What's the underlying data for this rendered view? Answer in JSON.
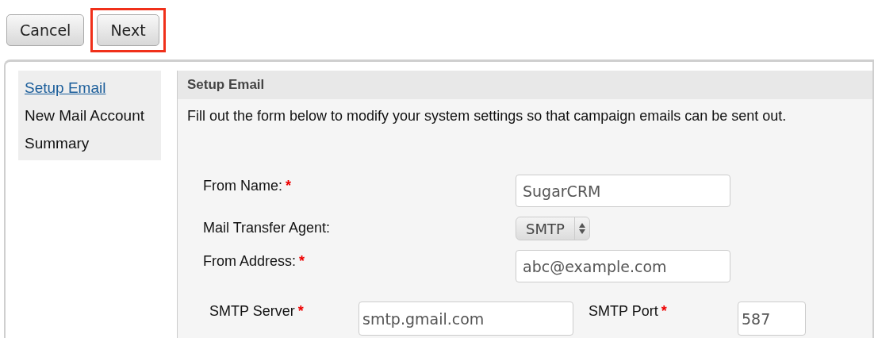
{
  "buttons": [
    {
      "label": "Cancel",
      "highlighted": false
    },
    {
      "label": "Next",
      "highlighted": true
    }
  ],
  "sidebar": {
    "items": [
      {
        "label": "Setup Email",
        "selected": true
      },
      {
        "label": "New Mail Account",
        "selected": false
      },
      {
        "label": "Summary",
        "selected": false
      }
    ]
  },
  "panel": {
    "title": "Setup Email",
    "description": "Fill out the form below to modify your system settings so that campaign emails can be sent out.",
    "fields": [
      {
        "label": "From Name:",
        "required_mark": "*",
        "kind": "text",
        "value": "SugarCRM"
      },
      {
        "label": "Mail Transfer Agent:",
        "kind": "select",
        "value": "SMTP"
      },
      {
        "label": "From Address:",
        "required_mark": "*",
        "kind": "text",
        "value": "abc@example.com"
      }
    ],
    "server_row": [
      {
        "label": "SMTP Server",
        "required_mark": "*",
        "value": "smtp.gmail.com"
      },
      {
        "label": "SMTP Port",
        "required_mark": "*",
        "value": "587"
      }
    ]
  }
}
